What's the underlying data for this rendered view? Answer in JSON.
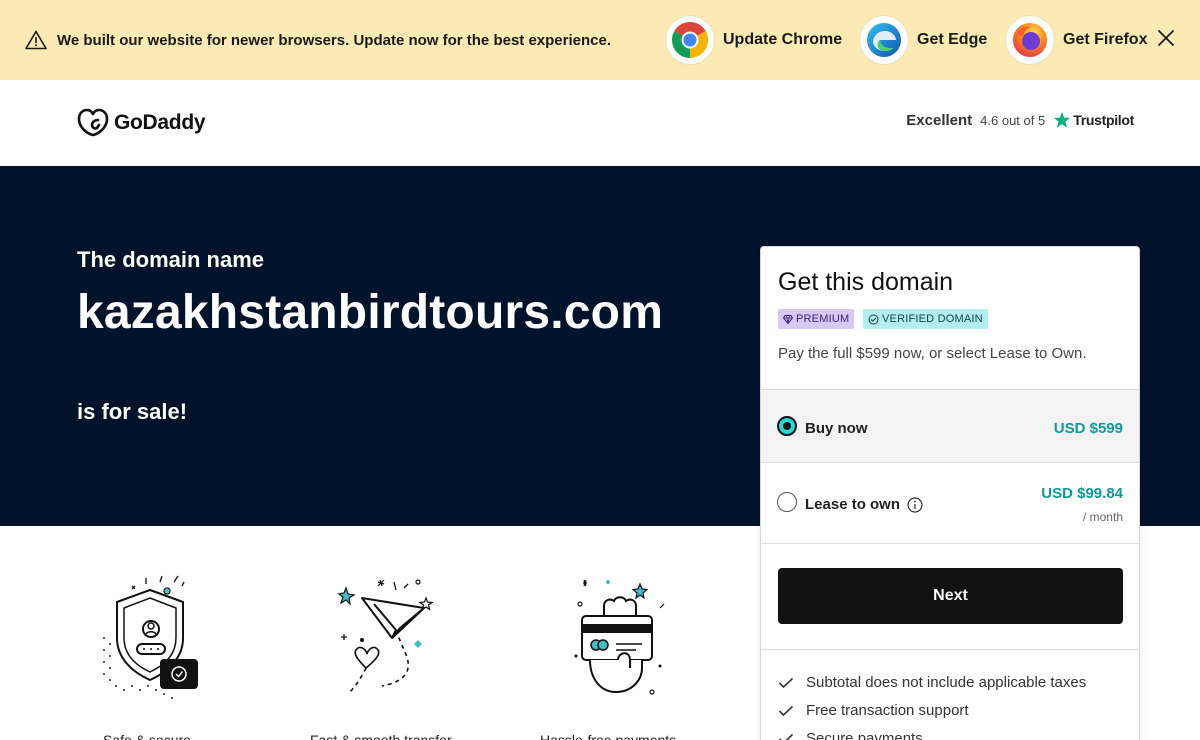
{
  "banner": {
    "message": "We built our website for newer browsers. Update now for the best experience.",
    "browsers": [
      {
        "label": "Update Chrome",
        "icon": "chrome-icon"
      },
      {
        "label": "Get Edge",
        "icon": "edge-icon"
      },
      {
        "label": "Get Firefox",
        "icon": "firefox-icon"
      }
    ],
    "bg_color": "#fbeab3"
  },
  "header": {
    "logo_text": "GoDaddy",
    "trust_rating_word": "Excellent",
    "trust_score": "4.6 out of 5",
    "trust_brand": "Trustpilot"
  },
  "hero": {
    "pre_text": "The domain name",
    "domain": "kazakhstanbirdtours.com",
    "post_text": "is for sale!",
    "bg_color": "#00132b"
  },
  "features": [
    {
      "icon": "shield-check-illustration",
      "caption": "Safe & secure"
    },
    {
      "icon": "paper-plane-illustration",
      "caption": "Fast & smooth transfer"
    },
    {
      "icon": "card-payment-illustration",
      "caption": "Hassle-free payments"
    }
  ],
  "card": {
    "title": "Get this domain",
    "badge_premium": "PREMIUM",
    "badge_verified": "VERIFIED DOMAIN",
    "description": "Pay the full $599 now, or select Lease to Own.",
    "options": [
      {
        "label": "Buy now",
        "price": "USD $599",
        "selected": true
      },
      {
        "label": "Lease to own",
        "price": "USD $99.84",
        "per": "/ month",
        "selected": false
      }
    ],
    "next_label": "Next",
    "checks": [
      "Subtotal does not include applicable taxes",
      "Free transaction support",
      "Secure payments"
    ],
    "accent_color": "#1bdbdb",
    "price_color": "#0e9a9a"
  }
}
